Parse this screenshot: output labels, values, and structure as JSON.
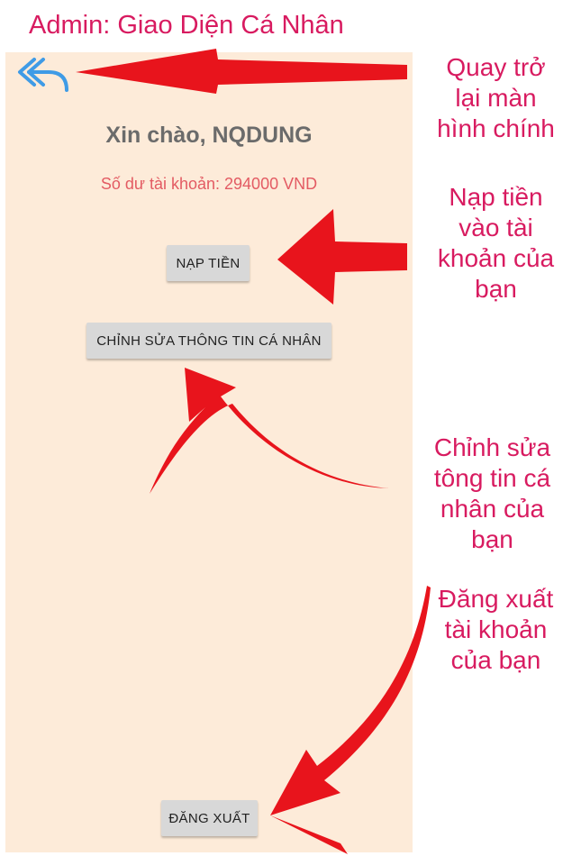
{
  "page_title": "Admin: Giao Diện Cá Nhân",
  "screen": {
    "back_icon": "back-arrow-icon",
    "greeting": "Xin chào, NQDUNG",
    "balance": "Số dư tài khoản: 294000 VND",
    "topup_label": "NẠP TIỀN",
    "edit_label": "CHỈNH SỬA THÔNG TIN CÁ NHÂN",
    "logout_label": "ĐĂNG XUẤT"
  },
  "annotations": {
    "back": [
      "Quay trở",
      "lại màn",
      "hình chính"
    ],
    "topup": [
      "Nạp tiền",
      "vào tài",
      "khoản của",
      "bạn"
    ],
    "edit": [
      "Chỉnh sửa",
      "tông tin cá",
      "nhân của",
      "bạn"
    ],
    "logout": [
      "Đăng xuất",
      "tài khoản",
      "của bạn"
    ]
  },
  "colors": {
    "annotation": "#d81b60",
    "screen_background": "#fdebd9",
    "arrow": "#e8141c",
    "balance_text": "#e35b63",
    "back_icon": "#3f9be6"
  }
}
